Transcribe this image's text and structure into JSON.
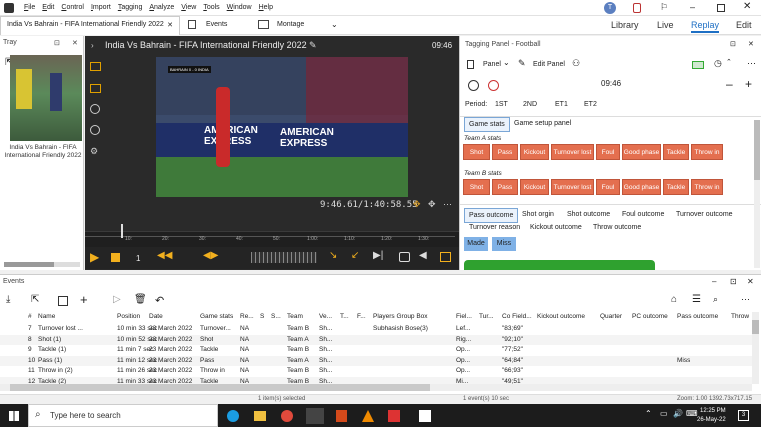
{
  "menubar": {
    "items": [
      "File",
      "Edit",
      "Control",
      "Import",
      "Tagging",
      "Analyze",
      "View",
      "Tools",
      "Window",
      "Help"
    ],
    "user_initial": "T"
  },
  "tabrow": {
    "doc_tab": "India Vs Bahrain - FIFA International Friendly 2022",
    "events_tab": "Events",
    "montage_tab": "Montage",
    "modes": [
      "Library",
      "Live",
      "Replay",
      "Edit"
    ],
    "active_mode": "Replay"
  },
  "tray": {
    "title": "Tray",
    "item_label": "India Vs Bahrain - FIFA International Friendly 2022"
  },
  "video": {
    "title": "India Vs Bahrain - FIFA International Friendly 2022",
    "clock": "09:46",
    "timecode": "9:46.61/1:40:58.55",
    "scoreboard": "BAHRAIN  0 - 0  INDIA",
    "ad_text": "AMERICAN EXPRESS",
    "timeline_ticks": [
      "10:",
      "20:",
      "30:",
      "40:",
      "50:",
      "1:00:",
      "1:10:",
      "1:20:",
      "1:30:"
    ],
    "speed": "1"
  },
  "tagging": {
    "title": "Tagging Panel - Football",
    "panel_label": "Panel",
    "edit_panel_label": "Edit Panel",
    "clock": "09:46",
    "period_label": "Period:",
    "periods": [
      "1ST",
      "2ND",
      "ET1",
      "ET2"
    ],
    "tabs": [
      "Game stats",
      "Game setup panel"
    ],
    "team_a_label": "Team A stats",
    "team_b_label": "Team B stats",
    "buttons": [
      "Shot",
      "Pass",
      "Kickout",
      "Turnover lost",
      "Foul",
      "Good phase",
      "Tackle",
      "Throw in"
    ],
    "outcome_tabs": [
      "Pass outcome",
      "Shot orgin",
      "Shot outcome",
      "Foul outcome",
      "Turnover outcome",
      "Turnover reason",
      "Kickout outcome",
      "Throw outcome"
    ],
    "pills": [
      "Made",
      "Miss"
    ]
  },
  "events": {
    "title": "Events",
    "columns": [
      "#",
      "Name",
      "Position",
      "Date",
      "Game stats",
      "Re...",
      "S",
      "S...",
      "Team",
      "Ve...",
      "T...",
      "F...",
      "Players Group Box",
      "Fiel...",
      "Tur...",
      "Co Field...",
      "Kickout outcome",
      "Quarter",
      "PC outcome",
      "Pass outcome",
      "Throw"
    ],
    "rows": [
      [
        "7",
        "Turnover lost ...",
        "10 min 33 sec",
        "23 March 2022",
        "Turnover...",
        "NA",
        "",
        "",
        "Team B",
        "Sh...",
        "",
        "",
        "Subhasish Bose(3)",
        "Lef...",
        "",
        "\"83;69\"",
        "",
        "",
        "",
        "",
        ""
      ],
      [
        "8",
        "Shot (1)",
        "10 min 52 sec",
        "23 March 2022",
        "Shot",
        "NA",
        "",
        "",
        "Team A",
        "Sh...",
        "",
        "",
        "",
        "Rig...",
        "",
        "\"92;10\"",
        "",
        "",
        "",
        "",
        ""
      ],
      [
        "9",
        "Tackle (1)",
        "11 min 7 sec",
        "23 March 2022",
        "Tackle",
        "NA",
        "",
        "",
        "Team B",
        "Sh...",
        "",
        "",
        "",
        "Op...",
        "",
        "\"77;52\"",
        "",
        "",
        "",
        "",
        ""
      ],
      [
        "10",
        "Pass (1)",
        "11 min 12 sec",
        "23 March 2022",
        "Pass",
        "NA",
        "",
        "",
        "Team A",
        "Sh...",
        "",
        "",
        "",
        "Op...",
        "",
        "\"64;84\"",
        "",
        "",
        "",
        "Miss",
        ""
      ],
      [
        "11",
        "Throw in (2)",
        "11 min 26 sec",
        "23 March 2022",
        "Throw in",
        "NA",
        "",
        "",
        "Team B",
        "Sh...",
        "",
        "",
        "",
        "Op...",
        "",
        "\"66;93\"",
        "",
        "",
        "",
        "",
        ""
      ],
      [
        "12",
        "Tackle (2)",
        "11 min 33 sec",
        "23 March 2022",
        "Tackle",
        "NA",
        "",
        "",
        "Team B",
        "Sh...",
        "",
        "",
        "",
        "Mi...",
        "",
        "\"49;51\"",
        "",
        "",
        "",
        "",
        ""
      ]
    ]
  },
  "status": {
    "selected": "1 item(s) selected",
    "count": "1 event(s)  10 sec",
    "zoom": "Zoom: 1.00  1392.73x717.15"
  },
  "taskbar": {
    "search_placeholder": "Type here to search",
    "time": "12:25 PM",
    "date": "26-May-22",
    "notif_count": "3"
  },
  "colors": {
    "accent": "#1e6fc4",
    "tag_button": "#e46f4f",
    "pill": "#7fb1e6",
    "video_bg": "#2a2a2a"
  }
}
